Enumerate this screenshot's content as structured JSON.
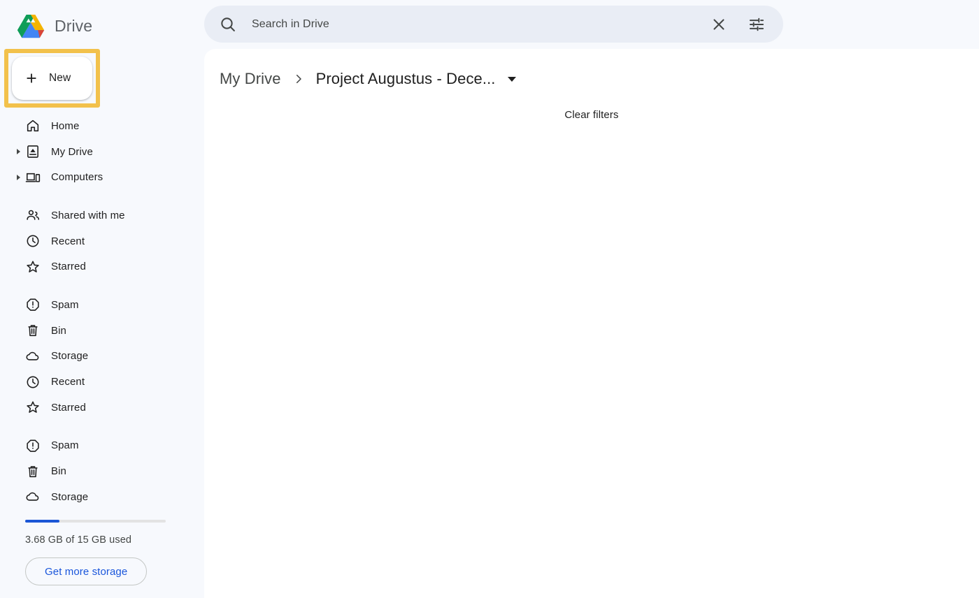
{
  "app": {
    "name": "Drive",
    "logo_icon": "google-drive-logo",
    "sidebar_bg": "#f7f9fd",
    "accent_blue": "#1a56db",
    "highlight_color": "#f2c14b"
  },
  "sidebar": {
    "new_button": {
      "label": "New",
      "icon": "plus-icon",
      "highlighted": true
    },
    "groups": [
      {
        "items": [
          {
            "label": "Home",
            "icon": "home-icon",
            "expandable": false
          },
          {
            "label": "My Drive",
            "icon": "my-drive-icon",
            "expandable": true
          },
          {
            "label": "Computers",
            "icon": "computers-icon",
            "expandable": true
          }
        ]
      },
      {
        "items": [
          {
            "label": "Shared with me",
            "icon": "people-icon",
            "expandable": false
          },
          {
            "label": "Recent",
            "icon": "clock-icon",
            "expandable": false
          },
          {
            "label": "Starred",
            "icon": "star-icon",
            "expandable": false
          }
        ]
      },
      {
        "items": [
          {
            "label": "Spam",
            "icon": "spam-icon",
            "expandable": false
          },
          {
            "label": "Bin",
            "icon": "trash-icon",
            "expandable": false
          },
          {
            "label": "Storage",
            "icon": "cloud-icon",
            "expandable": false
          },
          {
            "label": "Recent",
            "icon": "clock-icon",
            "expandable": false
          },
          {
            "label": "Starred",
            "icon": "star-icon",
            "expandable": false
          }
        ]
      },
      {
        "items": [
          {
            "label": "Spam",
            "icon": "spam-icon",
            "expandable": false
          },
          {
            "label": "Bin",
            "icon": "trash-icon",
            "expandable": false
          },
          {
            "label": "Storage",
            "icon": "cloud-icon",
            "expandable": false
          }
        ]
      }
    ],
    "storage": {
      "used_text": "3.68 GB of 15 GB used",
      "used_percent": 24.5,
      "upgrade_label": "Get more storage"
    }
  },
  "search": {
    "placeholder": "Search in Drive",
    "value": "",
    "search_icon": "search-icon",
    "clear_icon": "close-icon",
    "filter_icon": "tune-icon"
  },
  "main": {
    "breadcrumb": {
      "root": "My Drive",
      "separator_icon": "chevron-right-icon",
      "current": "Project Augustus - Dece...",
      "caret_icon": "caret-down-icon"
    },
    "clear_filters_label": "Clear filters"
  }
}
